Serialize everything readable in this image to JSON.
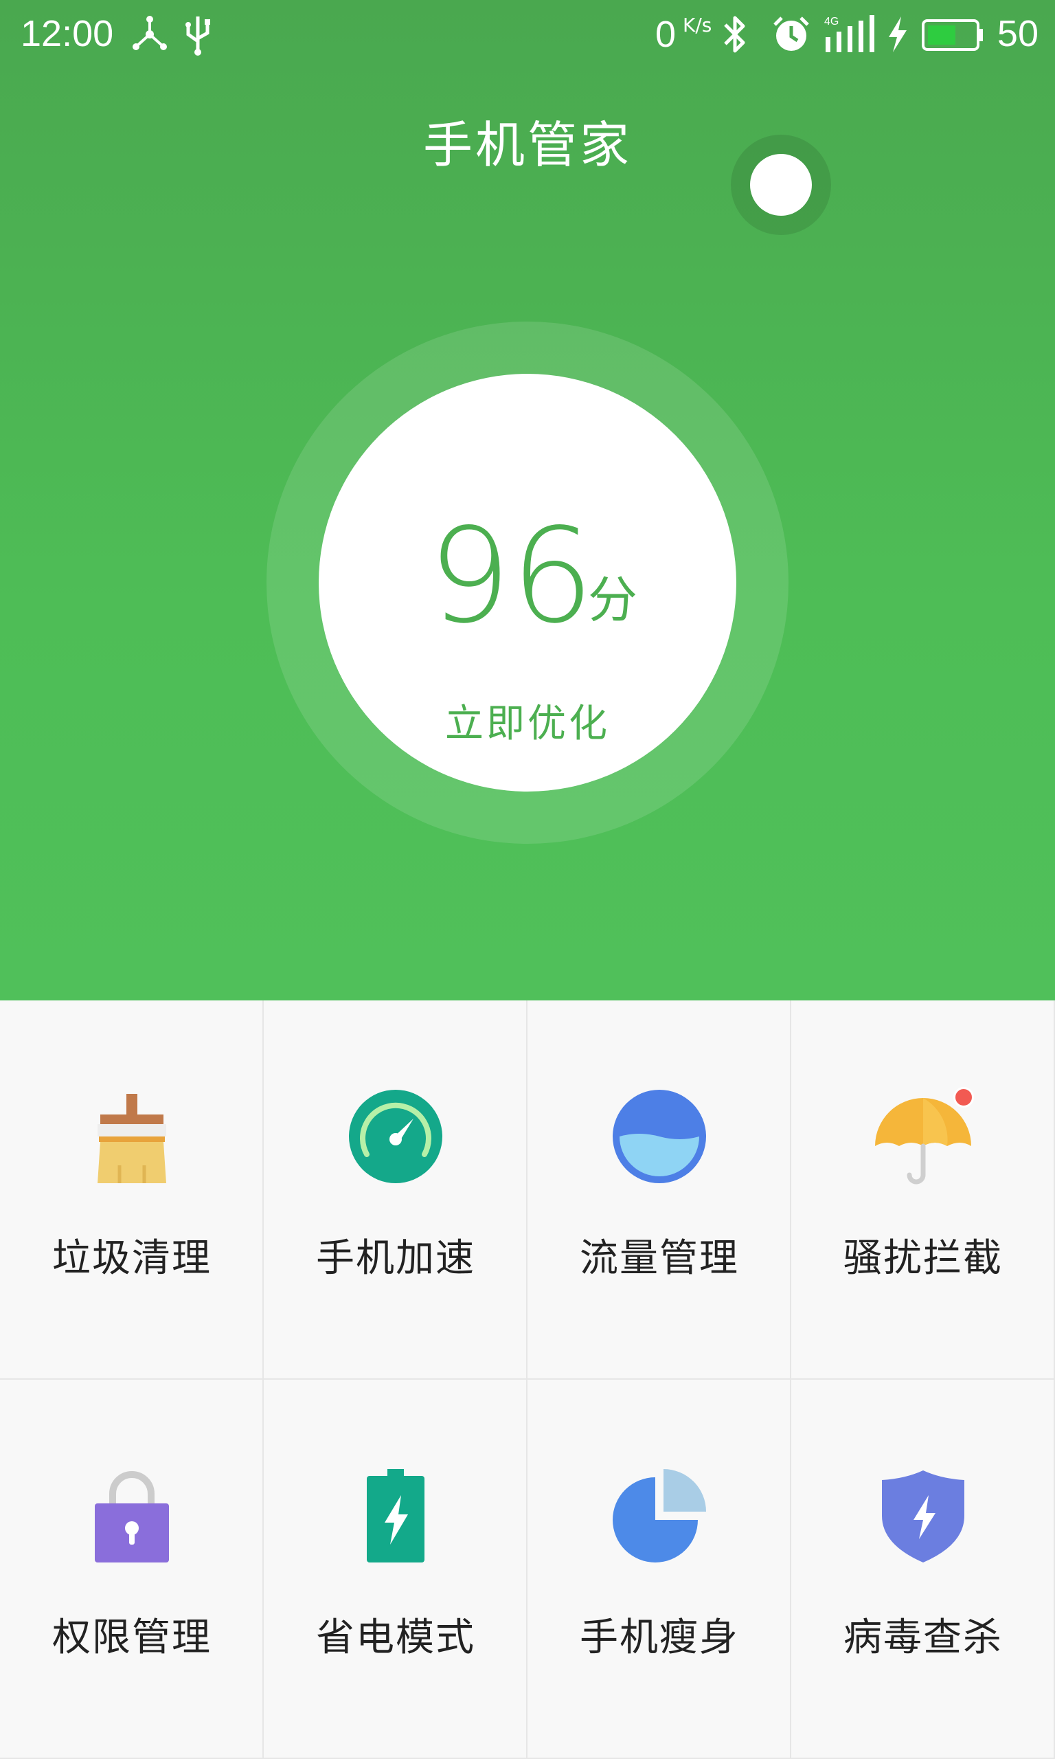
{
  "status_bar": {
    "time": "12:00",
    "net_speed": "0",
    "net_speed_unit": "K/s",
    "battery_level": "50",
    "icons": [
      "share-icon",
      "usb-icon",
      "bluetooth-icon",
      "alarm-icon",
      "4g-signal-icon",
      "charging-icon",
      "battery-icon"
    ]
  },
  "header": {
    "title": "手机管家"
  },
  "score": {
    "value": "96",
    "unit": "分",
    "action": "立即优化"
  },
  "features": [
    {
      "label": "垃圾清理",
      "icon": "broom-icon",
      "badge": false
    },
    {
      "label": "手机加速",
      "icon": "speedometer-icon",
      "badge": false
    },
    {
      "label": "流量管理",
      "icon": "water-level-icon",
      "badge": false
    },
    {
      "label": "骚扰拦截",
      "icon": "umbrella-icon",
      "badge": true
    },
    {
      "label": "权限管理",
      "icon": "padlock-icon",
      "badge": false
    },
    {
      "label": "省电模式",
      "icon": "battery-bolt-icon",
      "badge": false
    },
    {
      "label": "手机瘦身",
      "icon": "pie-chart-icon",
      "badge": false
    },
    {
      "label": "病毒查杀",
      "icon": "shield-bolt-icon",
      "badge": false
    }
  ],
  "colors": {
    "accent_green": "#4caf50",
    "badge_red": "#f25a52"
  }
}
